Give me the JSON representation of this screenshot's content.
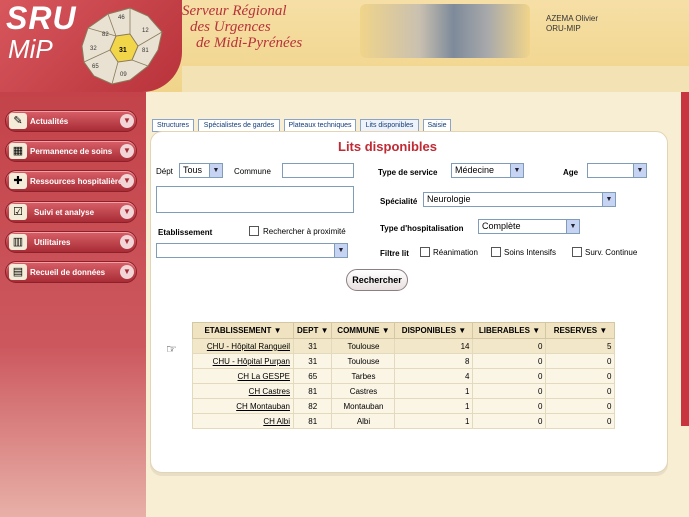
{
  "header": {
    "logo_line1": "SRU",
    "logo_line2": "MiP",
    "title_line1": "Serveur Régional",
    "title_line2": "des Urgences",
    "title_line3": "de Midi-Pyrénées",
    "user_name": "AZEMA Olivier",
    "user_org": "ORU-MIP",
    "map_labels": [
      "46",
      "82",
      "12",
      "32",
      "81",
      "31",
      "65",
      "09"
    ]
  },
  "sidebar": {
    "items": [
      {
        "label": "Actualités",
        "icon": "pencil-icon"
      },
      {
        "label": "Permanence de soins",
        "icon": "building-icon"
      },
      {
        "label": "Ressources hospitalières",
        "icon": "hospital-icon"
      },
      {
        "label": "Suivi et analyse",
        "icon": "checklist-icon"
      },
      {
        "label": "Utilitaires",
        "icon": "books-icon"
      },
      {
        "label": "Recueil de données",
        "icon": "database-icon"
      }
    ]
  },
  "tabs": [
    "Structures",
    "Spécialistes de gardes",
    "Plateaux techniques",
    "Lits disponibles",
    "Saisie"
  ],
  "form": {
    "title": "Lits disponibles",
    "dept_label": "Dépt",
    "dept_value": "Tous",
    "commune_label": "Commune",
    "commune_value": "",
    "etablissement_label": "Etablissement",
    "proximite_label": "Rechercher à proximité",
    "etablissement_value": "",
    "type_service_label": "Type de service",
    "type_service_value": "Médecine",
    "age_label": "Age",
    "age_value": "",
    "specialite_label": "Spécialité",
    "specialite_value": "Neurologie",
    "type_hosp_label": "Type d'hospitalisation",
    "type_hosp_value": "Complète",
    "filtre_label": "Filtre lit",
    "filtre_options": [
      "Réanimation",
      "Soins Intensifs",
      "Surv. Continue"
    ],
    "search_button": "Rechercher"
  },
  "table": {
    "columns": [
      "ETABLISSEMENT",
      "DEPT",
      "COMMUNE",
      "DISPONIBLES",
      "LIBERABLES",
      "RESERVES"
    ],
    "rows": [
      [
        "CHU - Hôpital Rangueil",
        "31",
        "Toulouse",
        "14",
        "0",
        "5"
      ],
      [
        "CHU - Hôpital Purpan",
        "31",
        "Toulouse",
        "8",
        "0",
        "0"
      ],
      [
        "CH La GESPE",
        "65",
        "Tarbes",
        "4",
        "0",
        "0"
      ],
      [
        "CH Castres",
        "81",
        "Castres",
        "1",
        "0",
        "0"
      ],
      [
        "CH Montauban",
        "82",
        "Montauban",
        "1",
        "0",
        "0"
      ],
      [
        "CH Albi",
        "81",
        "Albi",
        "1",
        "0",
        "0"
      ]
    ]
  }
}
